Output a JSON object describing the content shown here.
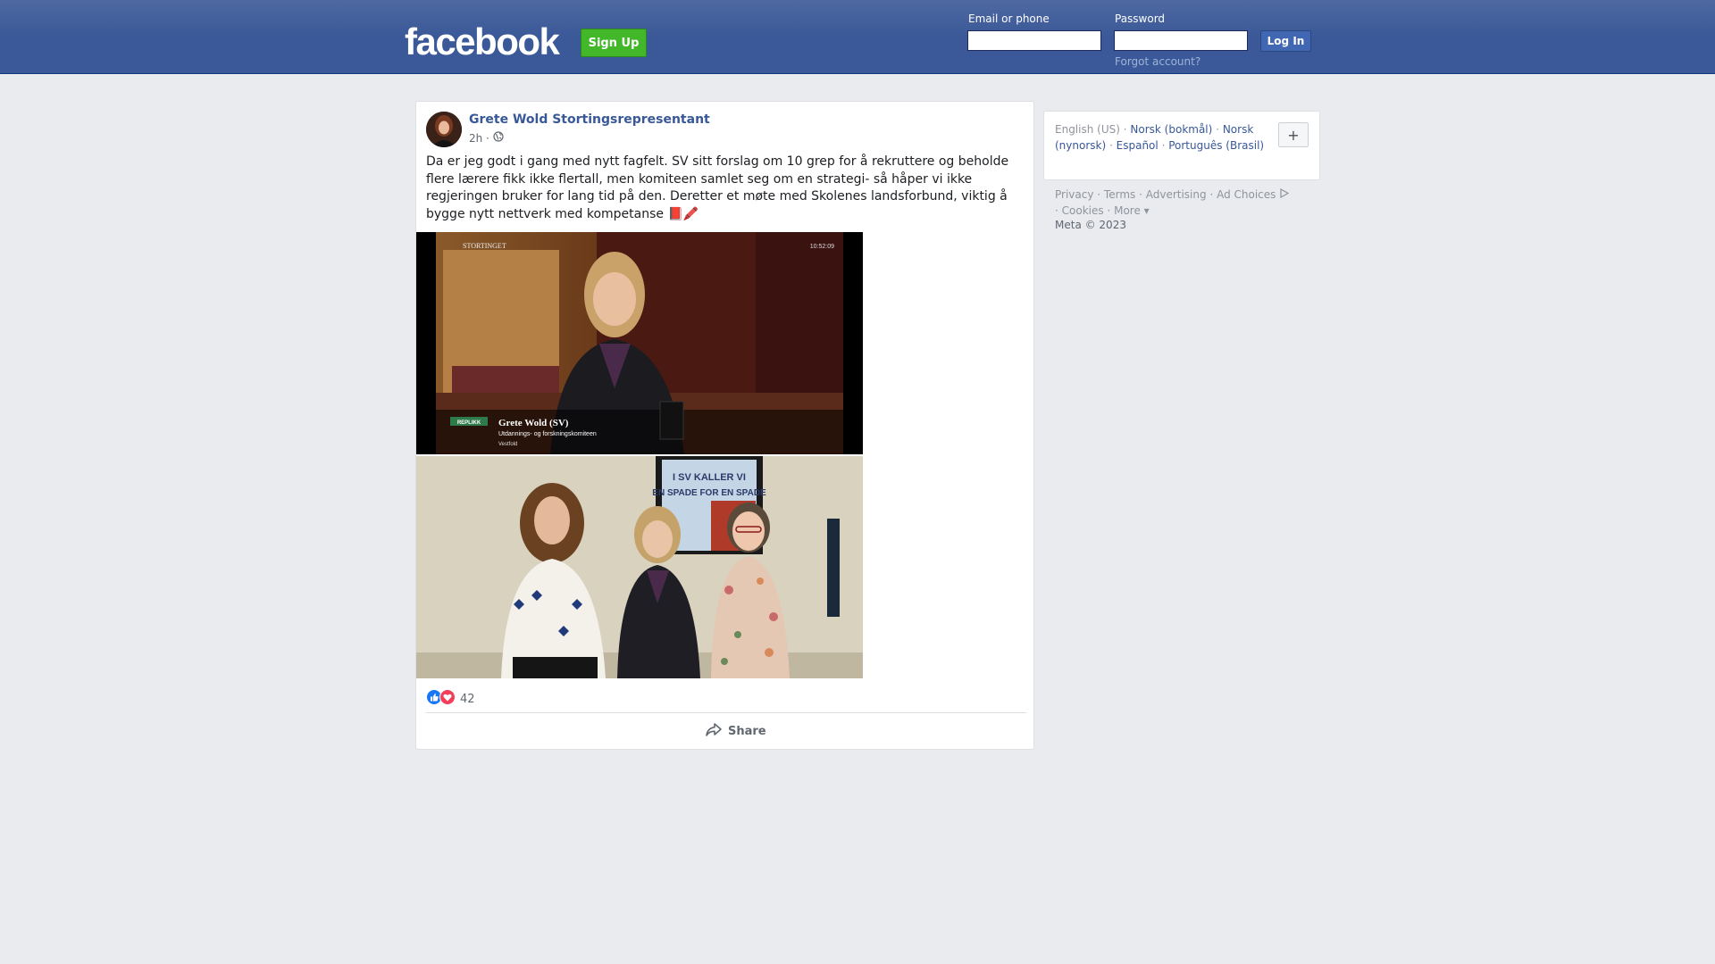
{
  "header": {
    "logo": "facebook",
    "signup_label": "Sign Up",
    "email_label": "Email or phone",
    "email_value": "",
    "password_label": "Password",
    "password_value": "",
    "login_label": "Log In",
    "forgot_label": "Forgot account?"
  },
  "post": {
    "author": "Grete Wold Stortingsrepresentant",
    "time": "2h ·",
    "privacy_icon": "globe-icon",
    "text": "Da er jeg godt i gang med nytt fagfelt. SV sitt forslag om 10 grep for å rekruttere og beholde flere lærere fikk ikke flertall, men komiteen samlet seg om en strategi- så håper vi ikke regjeringen bruker for lang tid på den. Deretter et møte med Skolenes landsforbund, viktig å bygge nytt nettverk med kompetanse 📕🖍️",
    "photo1": {
      "broadcaster": "STORTINGET",
      "clock": "10:52:09",
      "tag": "REPLIKK",
      "name": "Grete Wold (SV)",
      "committee": "Utdannings- og forskningskomiteen",
      "county": "Vestfold"
    },
    "photo2": {
      "poster_line1": "I SV KALLER VI",
      "poster_line2": "EN SPADE FOR EN SPADE"
    },
    "reaction_icons": [
      "like-icon",
      "love-icon"
    ],
    "reaction_count": "42",
    "share_label": "Share",
    "colors": {
      "link": "#385898",
      "like": "#1877f2",
      "love": "#f33e58"
    }
  },
  "sidebar": {
    "languages": {
      "current": "English (US)",
      "items": [
        "Norsk (bokmål)",
        "Norsk (nynorsk)",
        "Español",
        "Português (Brasil)"
      ],
      "separator": "·"
    },
    "add_language_label": "+",
    "footer_links": {
      "privacy": "Privacy",
      "terms": "Terms",
      "advertising": "Advertising",
      "ad_choices": "Ad Choices",
      "cookies": "Cookies",
      "more": "More"
    },
    "copyright": "Meta © 2023"
  },
  "colors": {
    "header_bg": "#3b5998",
    "signup_bg": "#42b72a",
    "page_bg": "#e9ebee"
  }
}
